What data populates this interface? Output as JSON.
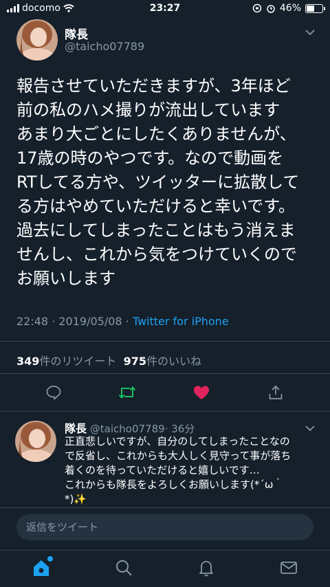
{
  "status_bar": {
    "carrier": "docomo",
    "time": "23:27",
    "battery": "46%",
    "battery_level": 0.46
  },
  "tweet": {
    "name": "隊長",
    "handle": "@taicho07789",
    "lines": [
      "報告させていただきますが、3年ほど",
      "前の私のハメ撮りが流出しています",
      "あまり大ごとにしたくありませんが、",
      "17歳の時のやつです。なので動画を",
      "RTしてる方や、ツイッターに拡散して",
      "る方はやめていただけると幸いです。",
      "過去にしてしまったことはもう消えま",
      "せんし、これから気をつけていくので",
      "お願いします"
    ],
    "timestamp": "22:48 · 2019/05/08 · ",
    "source": "Twitter for iPhone",
    "retweet_count": "349",
    "retweet_label": "件のリツイート",
    "like_count": "975",
    "like_label": "件のいいね"
  },
  "reply": {
    "name": "隊長",
    "handle": "@taicho07789",
    "time": "· 36分",
    "lines": [
      "正直悲しいですが、自分のしてしまったことなの",
      "で反省し、これからも大人しく見守って事が落ち",
      "着くのを待っていただけると嬉しいです…",
      "これからも隊長をよろしくお願いします(*´ω｀",
      "*)✨"
    ]
  },
  "compose": {
    "placeholder": "返信をツイート"
  },
  "colors": {
    "background": "#15202b",
    "accent": "#1da1f2",
    "retweet": "#17bf63",
    "like": "#e0245e",
    "muted": "#8899a6"
  },
  "icons": [
    "wifi-icon",
    "chevron-down-icon",
    "reply-icon",
    "retweet-icon",
    "like-icon",
    "share-icon",
    "home-icon",
    "search-icon",
    "notifications-icon",
    "messages-icon"
  ]
}
